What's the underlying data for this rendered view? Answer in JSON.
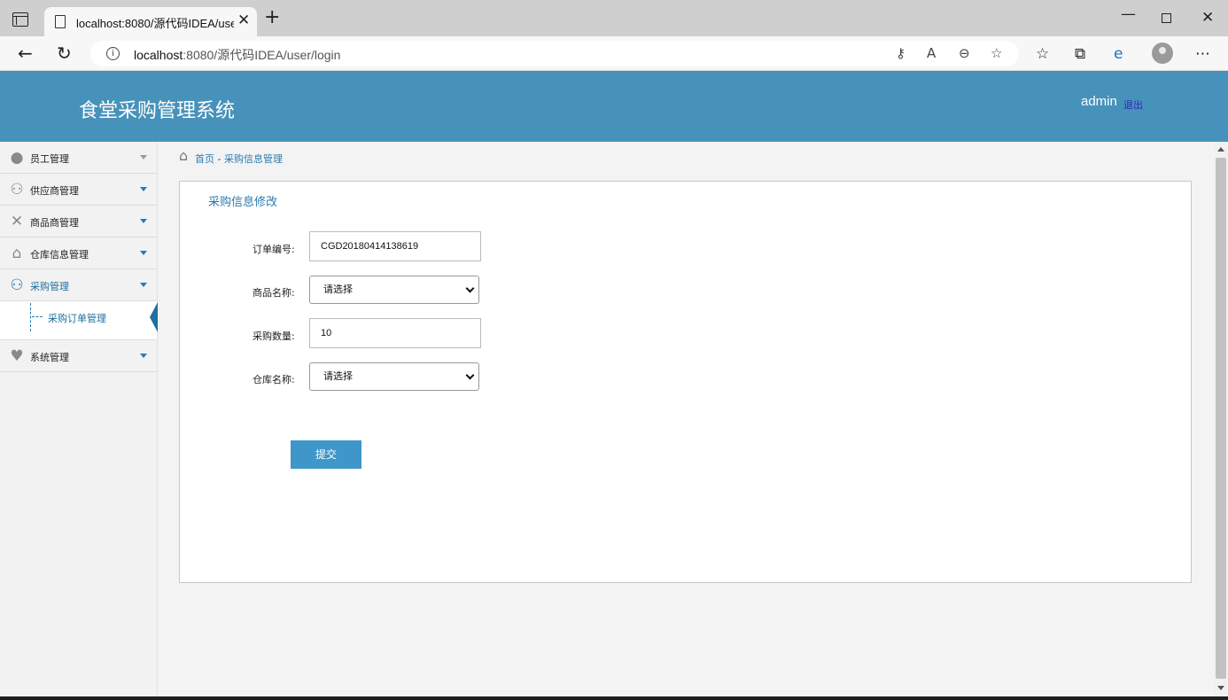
{
  "browser": {
    "tab_title": "localhost:8080/源代码IDEA/user/",
    "url_host": "localhost",
    "url_rest": ":8080/源代码IDEA/user/login",
    "new_tab": "+",
    "close": "✕"
  },
  "header": {
    "title": "食堂采购管理系统",
    "user": "admin",
    "logout": "退出"
  },
  "sidebar": {
    "items": [
      {
        "label": "员工管理",
        "icon": "user-icon"
      },
      {
        "label": "供应商管理",
        "icon": "users-icon"
      },
      {
        "label": "商品商管理",
        "icon": "wrench-icon"
      },
      {
        "label": "仓库信息管理",
        "icon": "home-icon"
      },
      {
        "label": "采购管理",
        "icon": "users-icon"
      },
      {
        "label": "系统管理",
        "icon": "heart-icon"
      }
    ],
    "submenu": {
      "label": "采购订单管理"
    }
  },
  "breadcrumb": {
    "home": "首页",
    "separator": "-",
    "current": "采购信息管理"
  },
  "form": {
    "title": "采购信息修改",
    "order_no_label": "订单编号:",
    "order_no_value": "CGD20180414138619",
    "product_label": "商品名称:",
    "product_value": "请选择",
    "quantity_label": "采购数量:",
    "quantity_value": "10",
    "warehouse_label": "仓库名称:",
    "warehouse_value": "请选择",
    "submit": "提交"
  },
  "colors": {
    "header_bg": "#4692ba",
    "accent": "#2a7bb0",
    "button_bg": "#3f96c9"
  }
}
